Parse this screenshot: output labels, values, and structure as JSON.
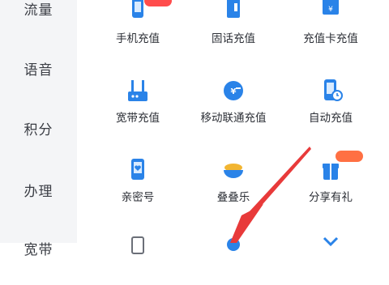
{
  "sidebar": {
    "items": [
      {
        "label": "流量"
      },
      {
        "label": "语音"
      },
      {
        "label": "积分"
      },
      {
        "label": "办理"
      },
      {
        "label": "宽带"
      }
    ]
  },
  "services": [
    {
      "label": "手机充值",
      "icon": "phone-recharge-icon",
      "badge": ""
    },
    {
      "label": "固话充值",
      "icon": "landline-recharge-icon"
    },
    {
      "label": "充值卡充值",
      "icon": "recharge-card-icon"
    },
    {
      "label": "宽带充值",
      "icon": "router-icon"
    },
    {
      "label": "移动联通充值",
      "icon": "coin-icon"
    },
    {
      "label": "自动充值",
      "icon": "auto-recharge-icon"
    },
    {
      "label": "亲密号",
      "icon": "heart-phone-icon"
    },
    {
      "label": "叠叠乐",
      "icon": "bowl-icon"
    },
    {
      "label": "分享有礼",
      "icon": "gift-icon",
      "badge": ""
    },
    {
      "icon": "partial-icon-1"
    },
    {
      "icon": "partial-icon-2"
    },
    {
      "icon": "partial-icon-3"
    }
  ],
  "colors": {
    "accent": "#2a83e8",
    "badge": "#ff5a4d",
    "arrow": "#e83a3a",
    "sidebar_bg": "#f4f5f7"
  }
}
